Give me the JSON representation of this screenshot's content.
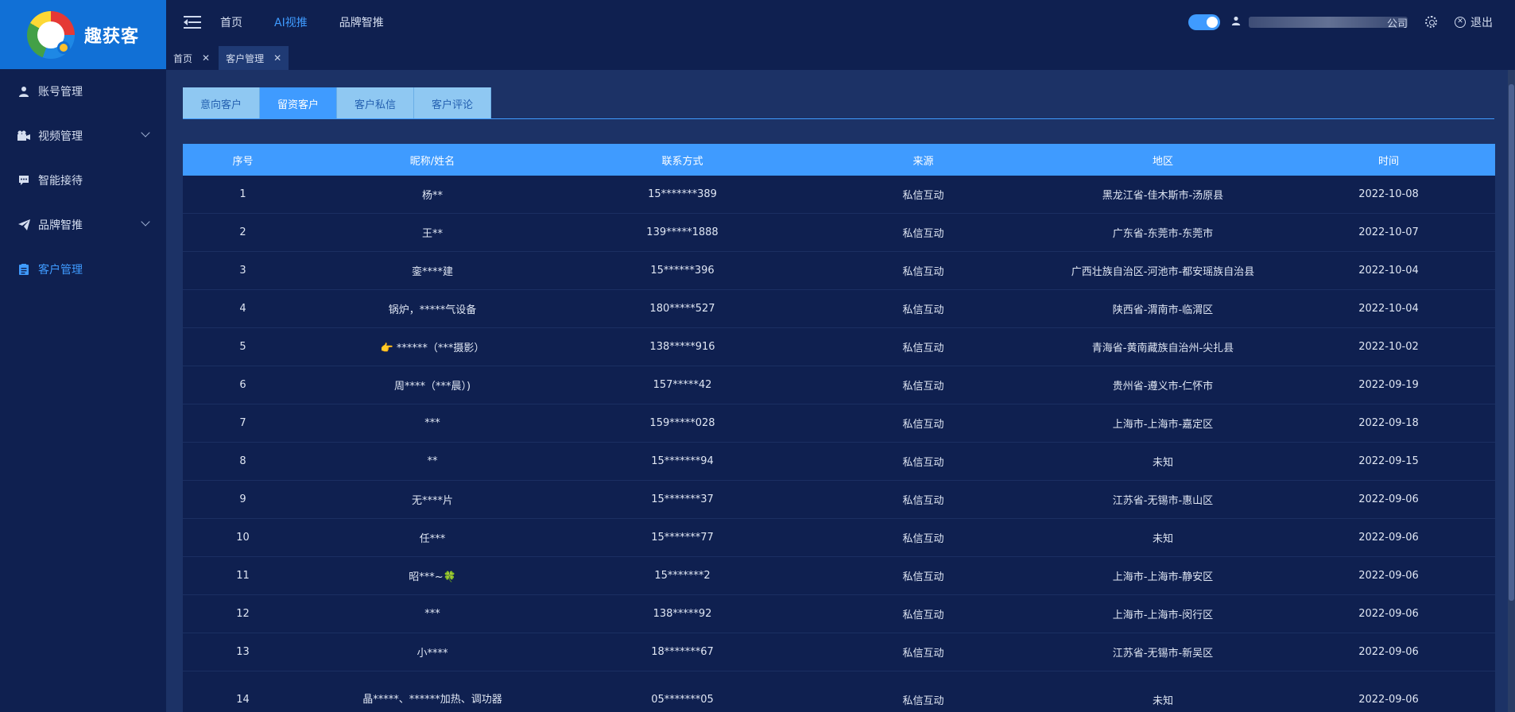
{
  "brand": {
    "name": "趣获客"
  },
  "sidebar": {
    "items": [
      {
        "label": "账号管理",
        "icon": "user-icon",
        "has_arrow": false,
        "active": false
      },
      {
        "label": "视频管理",
        "icon": "video-icon",
        "has_arrow": true,
        "active": false
      },
      {
        "label": "智能接待",
        "icon": "chat-icon",
        "has_arrow": false,
        "active": false
      },
      {
        "label": "品牌智推",
        "icon": "paper-plane-icon",
        "has_arrow": true,
        "active": false
      },
      {
        "label": "客户管理",
        "icon": "clipboard-icon",
        "has_arrow": false,
        "active": true
      }
    ]
  },
  "header": {
    "nav": [
      {
        "label": "首页",
        "active": false
      },
      {
        "label": "AI视推",
        "active": true
      },
      {
        "label": "品牌智推",
        "active": false
      }
    ],
    "company_suffix": "公司",
    "logout_label": "退出"
  },
  "page_tabs": [
    {
      "label": "首页",
      "active": false
    },
    {
      "label": "客户管理",
      "active": true
    }
  ],
  "sub_tabs": [
    {
      "label": "意向客户",
      "active": false
    },
    {
      "label": "留资客户",
      "active": true
    },
    {
      "label": "客户私信",
      "active": false
    },
    {
      "label": "客户评论",
      "active": false
    }
  ],
  "table": {
    "headers": [
      "序号",
      "昵称/姓名",
      "联系方式",
      "来源",
      "地区",
      "时间"
    ],
    "rows": [
      [
        "1",
        "杨**",
        "15*******389",
        "私信互动",
        "黑龙江省-佳木斯市-汤原县",
        "2022-10-08"
      ],
      [
        "2",
        "王**",
        "139*****1888",
        "私信互动",
        "广东省-东莞市-东莞市",
        "2022-10-07"
      ],
      [
        "3",
        "銮****建",
        "15******396",
        "私信互动",
        "广西壮族自治区-河池市-都安瑶族自治县",
        "2022-10-04"
      ],
      [
        "4",
        "锅炉，*****气设备",
        "180*****527",
        "私信互动",
        "陕西省-渭南市-临渭区",
        "2022-10-04"
      ],
      [
        "5",
        "👉 ******（***摄影）",
        "138*****916",
        "私信互动",
        "青海省-黄南藏族自治州-尖扎县",
        "2022-10-02"
      ],
      [
        "6",
        "周****（***晨）)",
        "157*****42",
        "私信互动",
        "贵州省-遵义市-仁怀市",
        "2022-09-19"
      ],
      [
        "7",
        "***",
        "159*****028",
        "私信互动",
        "上海市-上海市-嘉定区",
        "2022-09-18"
      ],
      [
        "8",
        "**",
        "15*******94",
        "私信互动",
        "未知",
        "2022-09-15"
      ],
      [
        "9",
        "无****片",
        "15*******37",
        "私信互动",
        "江苏省-无锡市-惠山区",
        "2022-09-06"
      ],
      [
        "10",
        "任***",
        "15*******77",
        "私信互动",
        "未知",
        "2022-09-06"
      ],
      [
        "11",
        "昭***~🍀",
        "15*******2",
        "私信互动",
        "上海市-上海市-静安区",
        "2022-09-06"
      ],
      [
        "12",
        "***",
        "138*****92",
        "私信互动",
        "上海市-上海市-闵行区",
        "2022-09-06"
      ],
      [
        "13",
        "小****",
        "18*******67",
        "私信互动",
        "江苏省-无锡市-新吴区",
        "2022-09-06"
      ],
      [
        "14",
        "晶*****、******加热、调功器",
        "05*******05",
        "私信互动",
        "未知",
        "2022-09-06"
      ]
    ]
  },
  "colors": {
    "accent": "#3f9bff",
    "sidebar_bg": "#0f2050",
    "content_bg": "#1c3266",
    "logo_bg": "#1170d6"
  }
}
